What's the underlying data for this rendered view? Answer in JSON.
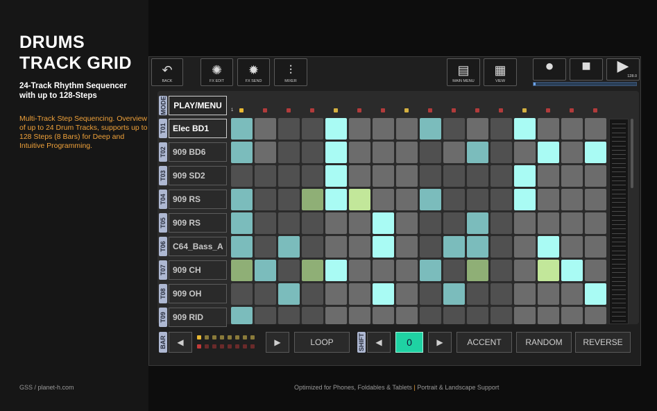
{
  "promo": {
    "title_line1": "DRUMS",
    "title_line2": "TRACK GRID",
    "subtitle": "24-Track Rhythm Sequencer with up to 128-Steps",
    "description": "Multi-Track Step Sequencing. Overview of up to 24 Drum Tracks, supports up to 128 Steps (8 Bars) for Deep and Intuitive Programming.",
    "footer_left": "GSS / planet-h.com",
    "footer_center_a": "Optimized for Phones, Foldables & Tablets",
    "footer_center_sep": " | ",
    "footer_center_b": "Portrait & Landscape Support"
  },
  "toolbar": {
    "back": {
      "label": "BACK",
      "icon": "undo-arrow-icon",
      "glyph": "↶"
    },
    "fx_edit": {
      "label": "FX EDIT",
      "icon": "fx-edit-icon",
      "glyph": "✺"
    },
    "fx_send": {
      "label": "FX SEND",
      "icon": "fx-send-icon",
      "glyph": "✹"
    },
    "mixer": {
      "label": "MIXER",
      "icon": "mixer-icon",
      "glyph": "⫶"
    },
    "main_menu": {
      "label": "MAIN MENU",
      "icon": "main-menu-icon",
      "glyph": "▤"
    },
    "view": {
      "label": "VIEW",
      "icon": "grid-view-icon",
      "glyph": "▦"
    },
    "record": {
      "icon": "record-icon",
      "glyph": "●"
    },
    "stop": {
      "icon": "stop-icon",
      "glyph": "■"
    },
    "play": {
      "icon": "play-icon",
      "glyph": "▶"
    },
    "tempo": "128.0",
    "song_progress": 0.02
  },
  "grid": {
    "mode_label": "MODE",
    "play_menu": "PLAY/MENU",
    "first_step_number": "1",
    "step_indicator_colors": [
      "#e9b833",
      "#b23b3b",
      "#b23b3b",
      "#b23b3b",
      "#d4b040",
      "#b23b3b",
      "#b23b3b",
      "#d4b040",
      "#b23b3b",
      "#b23b3b",
      "#b23b3b",
      "#b23b3b",
      "#d4b040",
      "#b23b3b",
      "#b23b3b",
      "#b23b3b"
    ],
    "tracks": [
      {
        "id": "T01",
        "name": "Elec BD1",
        "selected": true,
        "steps": [
          3,
          0,
          1,
          1,
          2,
          0,
          0,
          0,
          3,
          1,
          0,
          1,
          2,
          0,
          0,
          0
        ]
      },
      {
        "id": "T02",
        "name": "909 BD6",
        "selected": false,
        "steps": [
          3,
          0,
          1,
          1,
          2,
          0,
          0,
          0,
          1,
          0,
          3,
          1,
          0,
          2,
          0,
          2
        ]
      },
      {
        "id": "T03",
        "name": "909 SD2",
        "selected": false,
        "steps": [
          1,
          1,
          1,
          1,
          2,
          0,
          0,
          0,
          1,
          1,
          1,
          1,
          2,
          0,
          0,
          0
        ]
      },
      {
        "id": "T04",
        "name": "909 RS",
        "selected": false,
        "steps": [
          3,
          1,
          1,
          4,
          2,
          5,
          0,
          0,
          3,
          1,
          1,
          1,
          2,
          0,
          0,
          0
        ]
      },
      {
        "id": "T05",
        "name": "909 RS",
        "selected": false,
        "steps": [
          3,
          1,
          1,
          1,
          0,
          0,
          2,
          0,
          1,
          1,
          3,
          1,
          0,
          0,
          0,
          0
        ]
      },
      {
        "id": "T06",
        "name": "C64_Bass_A",
        "selected": false,
        "steps": [
          3,
          1,
          3,
          1,
          0,
          0,
          2,
          0,
          1,
          3,
          3,
          1,
          0,
          2,
          0,
          0
        ]
      },
      {
        "id": "T07",
        "name": "909 CH",
        "selected": false,
        "steps": [
          4,
          3,
          1,
          4,
          2,
          0,
          0,
          0,
          3,
          1,
          4,
          1,
          0,
          5,
          2,
          0
        ]
      },
      {
        "id": "T08",
        "name": "909 OH",
        "selected": false,
        "steps": [
          1,
          1,
          3,
          1,
          0,
          0,
          2,
          0,
          1,
          3,
          1,
          1,
          0,
          0,
          0,
          2
        ]
      },
      {
        "id": "T09",
        "name": "909 RID",
        "selected": false,
        "steps": [
          3,
          1,
          1,
          1,
          0,
          0,
          0,
          0,
          1,
          1,
          1,
          1,
          0,
          0,
          0,
          0
        ]
      }
    ],
    "step_colors": {
      "off_light": "#6c6c6c",
      "off_dark": "#505050",
      "on_bright": "#a9fbf4",
      "on_muted": "#7bbcbc",
      "accent_green": "#8faf76",
      "accent_lime": "#c2e79a"
    }
  },
  "bottom": {
    "bar_label": "BAR",
    "prev_icon": "◀",
    "next_icon": "▶",
    "loop": "LOOP",
    "shift_label": "SHIFT",
    "shift_value": "0",
    "accent": "ACCENT",
    "random": "RANDOM",
    "reverse": "REVERSE",
    "bar_top_colors": [
      "#e9b833",
      "#8a7a3a",
      "#8a7a3a",
      "#8a7a3a",
      "#8a7a3a",
      "#8a7a3a",
      "#8a7a3a",
      "#8a7a3a"
    ],
    "bar_bottom_colors": [
      "#c23a3a",
      "#6a2a2a",
      "#6a2a2a",
      "#6a2a2a",
      "#6a2a2a",
      "#6a2a2a",
      "#6a2a2a",
      "#6a2a2a"
    ]
  }
}
